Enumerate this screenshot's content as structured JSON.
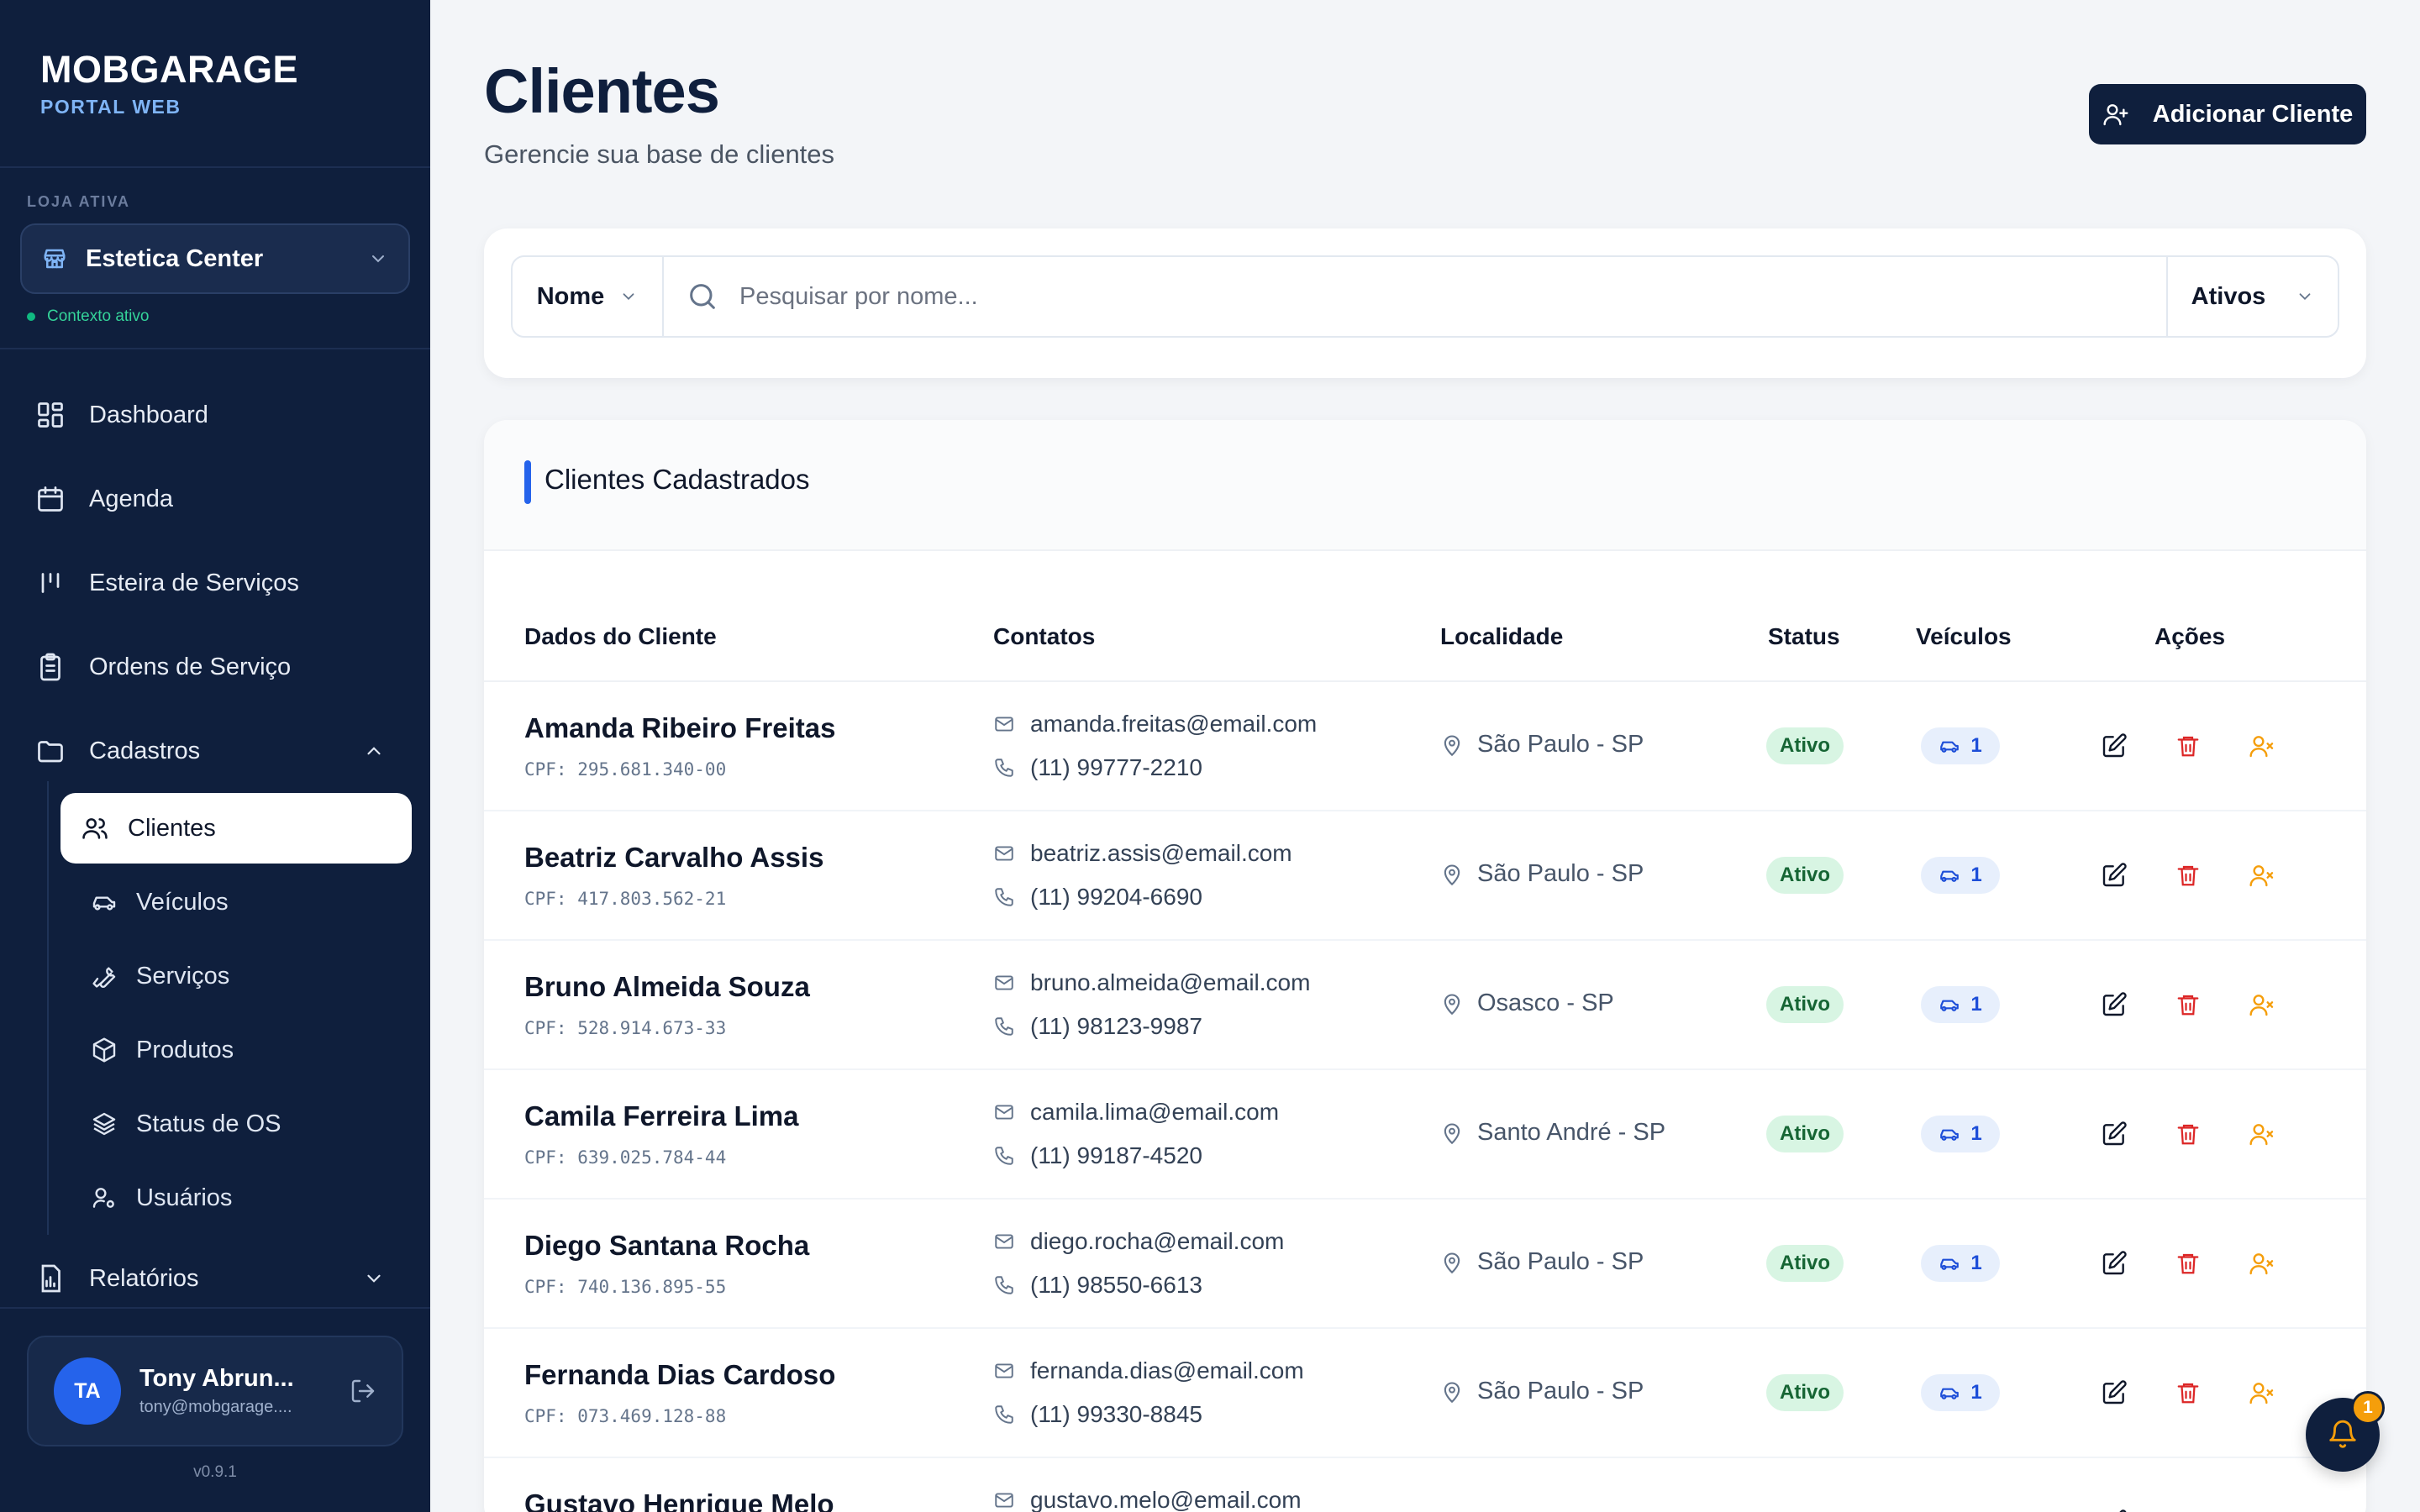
{
  "brand": {
    "title": "MOBGARAGE",
    "subtitle": "PORTAL WEB"
  },
  "store": {
    "section_label": "LOJA ATIVA",
    "name": "Estetica Center",
    "context_text": "Contexto ativo"
  },
  "nav": {
    "dashboard": "Dashboard",
    "agenda": "Agenda",
    "esteira": "Esteira de Serviços",
    "ordens": "Ordens de Serviço",
    "cadastros": "Cadastros",
    "relatorios": "Relatórios",
    "sub": {
      "clientes": "Clientes",
      "veiculos": "Veículos",
      "servicos": "Serviços",
      "produtos": "Produtos",
      "status_os": "Status de OS",
      "usuarios": "Usuários"
    }
  },
  "user": {
    "initials": "TA",
    "name": "Tony Abrun...",
    "email": "tony@mobgarage....",
    "version": "v0.9.1"
  },
  "header": {
    "title": "Clientes",
    "subtitle": "Gerencie sua base de clientes",
    "add_button": "Adicionar Cliente"
  },
  "filter": {
    "field": "Nome",
    "search_placeholder": "Pesquisar por nome...",
    "search_value": "",
    "status": "Ativos"
  },
  "table": {
    "title": "Clientes Cadastrados",
    "columns": {
      "dados": "Dados do Cliente",
      "contatos": "Contatos",
      "localidade": "Localidade",
      "status": "Status",
      "veiculos": "Veículos",
      "acoes": "Ações"
    },
    "rows": [
      {
        "name": "Amanda Ribeiro Freitas",
        "cpf": "CPF: 295.681.340-00",
        "email": "amanda.freitas@email.com",
        "phone": "(11) 99777-2210",
        "city": "São Paulo - SP",
        "status": "Ativo",
        "vehicles": "1"
      },
      {
        "name": "Beatriz Carvalho Assis",
        "cpf": "CPF: 417.803.562-21",
        "email": "beatriz.assis@email.com",
        "phone": "(11) 99204-6690",
        "city": "São Paulo - SP",
        "status": "Ativo",
        "vehicles": "1"
      },
      {
        "name": "Bruno Almeida Souza",
        "cpf": "CPF: 528.914.673-33",
        "email": "bruno.almeida@email.com",
        "phone": "(11) 98123-9987",
        "city": "Osasco - SP",
        "status": "Ativo",
        "vehicles": "1"
      },
      {
        "name": "Camila Ferreira Lima",
        "cpf": "CPF: 639.025.784-44",
        "email": "camila.lima@email.com",
        "phone": "(11) 99187-4520",
        "city": "Santo André - SP",
        "status": "Ativo",
        "vehicles": "1"
      },
      {
        "name": "Diego Santana Rocha",
        "cpf": "CPF: 740.136.895-55",
        "email": "diego.rocha@email.com",
        "phone": "(11) 98550-6613",
        "city": "São Paulo - SP",
        "status": "Ativo",
        "vehicles": "1"
      },
      {
        "name": "Fernanda Dias Cardoso",
        "cpf": "CPF: 073.469.128-88",
        "email": "fernanda.dias@email.com",
        "phone": "(11) 99330-8845",
        "city": "São Paulo - SP",
        "status": "Ativo",
        "vehicles": "1"
      },
      {
        "name": "Gustavo Henrique Melo",
        "cpf": "",
        "email": "gustavo.melo@email.com",
        "phone": "",
        "city": "",
        "status": "",
        "vehicles": ""
      }
    ]
  },
  "notifications": {
    "count": "1"
  },
  "colors": {
    "sidebar": "#0f1f3d",
    "accent": "#2563eb",
    "status_active_bg": "#d8f5e3",
    "delete": "#dc2626",
    "deactivate": "#f59e0b"
  }
}
